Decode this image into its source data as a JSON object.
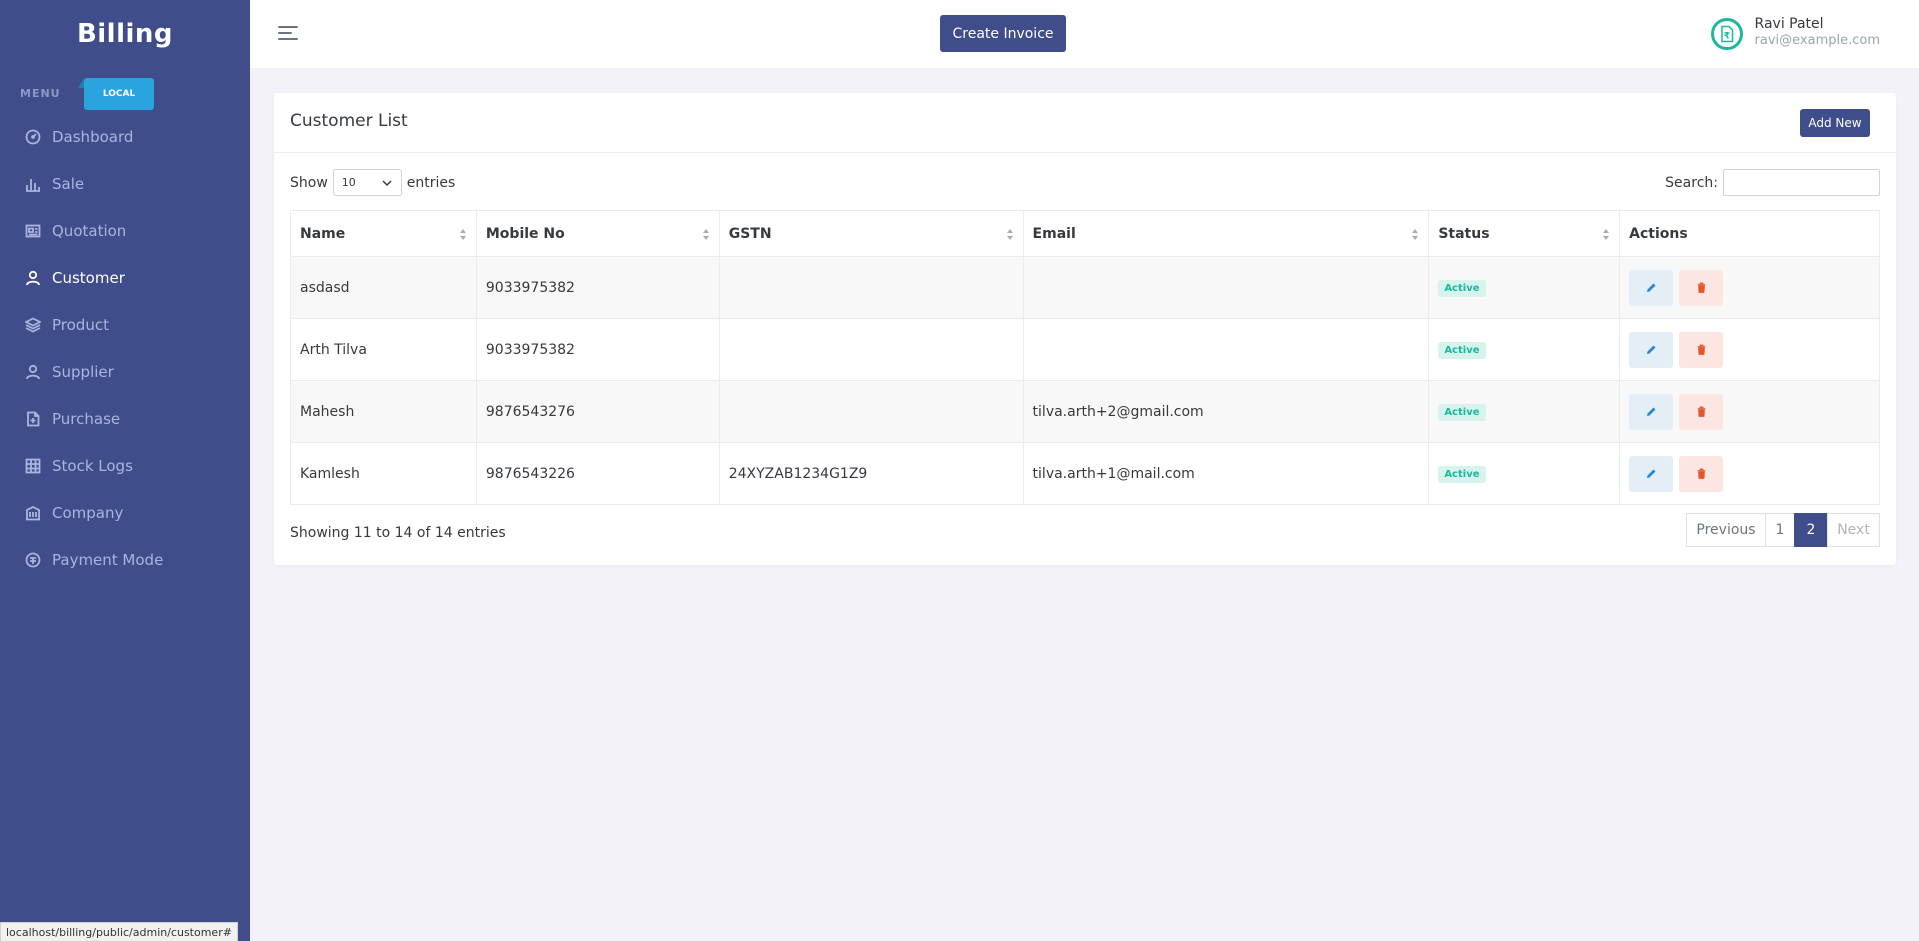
{
  "sidebar": {
    "brand": "Billing",
    "menu_title": "MENU",
    "env_badge": "LOCAL",
    "items": [
      {
        "label": "Dashboard",
        "icon": "dashboard-icon"
      },
      {
        "label": "Sale",
        "icon": "bar-chart-icon"
      },
      {
        "label": "Quotation",
        "icon": "newspaper-icon"
      },
      {
        "label": "Customer",
        "icon": "user-icon",
        "active": true
      },
      {
        "label": "Product",
        "icon": "layers-icon"
      },
      {
        "label": "Supplier",
        "icon": "user-icon"
      },
      {
        "label": "Purchase",
        "icon": "file-icon"
      },
      {
        "label": "Stock Logs",
        "icon": "table-icon"
      },
      {
        "label": "Company",
        "icon": "building-icon"
      },
      {
        "label": "Payment Mode",
        "icon": "payment-icon"
      }
    ]
  },
  "topbar": {
    "create_invoice": "Create Invoice",
    "user_name": "Ravi Patel",
    "user_email": "ravi@example.com"
  },
  "card": {
    "title": "Customer List",
    "add_new": "Add New",
    "show_label": "Show",
    "entries_label": "entries",
    "page_length": "10",
    "search_label": "Search:",
    "search_value": ""
  },
  "table": {
    "columns": [
      "Name",
      "Mobile No",
      "GSTN",
      "Email",
      "Status",
      "Actions"
    ],
    "rows": [
      {
        "name": "asdasd",
        "mobile": "9033975382",
        "gstn": "",
        "email": "",
        "status": "Active"
      },
      {
        "name": "Arth Tilva",
        "mobile": "9033975382",
        "gstn": "",
        "email": "",
        "status": "Active"
      },
      {
        "name": "Mahesh",
        "mobile": "9876543276",
        "gstn": "",
        "email": "tilva.arth+2@gmail.com",
        "status": "Active"
      },
      {
        "name": "Kamlesh",
        "mobile": "9876543226",
        "gstn": "24XYZAB1234G1Z9",
        "email": "tilva.arth+1@mail.com",
        "status": "Active"
      }
    ]
  },
  "footer": {
    "info": "Showing 11 to 14 of 14 entries",
    "previous": "Previous",
    "page1": "1",
    "page2": "2",
    "next": "Next"
  },
  "browser_status": "localhost/billing/public/admin/customer#",
  "colors": {
    "primary": "#3f4d8b",
    "accent": "#2aa3df",
    "success": "#1bb99a",
    "danger": "#f1556c"
  }
}
